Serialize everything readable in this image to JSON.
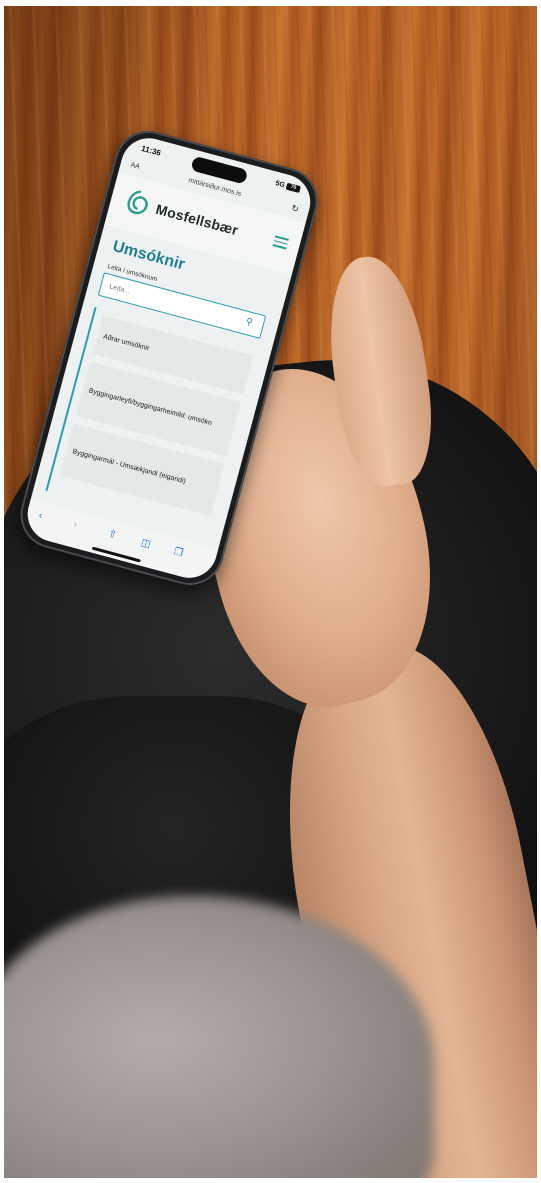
{
  "phone": {
    "status": {
      "time": "11:36",
      "signal": "5G",
      "battery": "70"
    },
    "browser": {
      "text_size": "AA",
      "url": "mittársiður.mos.is"
    },
    "site": {
      "brand": "Mosfellsbær",
      "page_title": "Umsóknir",
      "search_label": "Leita í umsóknum",
      "search_placeholder": "Leita...",
      "list_items": [
        {
          "label": "Aðrar umsóknir"
        },
        {
          "label": "Byggingarleyfi/byggingarheimild: umsókn"
        },
        {
          "label": "Byggingarmál - Umsækjandi (eigandi)"
        }
      ]
    }
  },
  "colors": {
    "accent": "#1d7f96",
    "brand_green": "#2a9d8f",
    "wood": "#b4602a"
  },
  "icons": [
    "search-icon",
    "menu-icon",
    "reload-icon",
    "back-icon",
    "forward-icon",
    "share-icon",
    "bookmarks-icon",
    "tabs-icon"
  ]
}
